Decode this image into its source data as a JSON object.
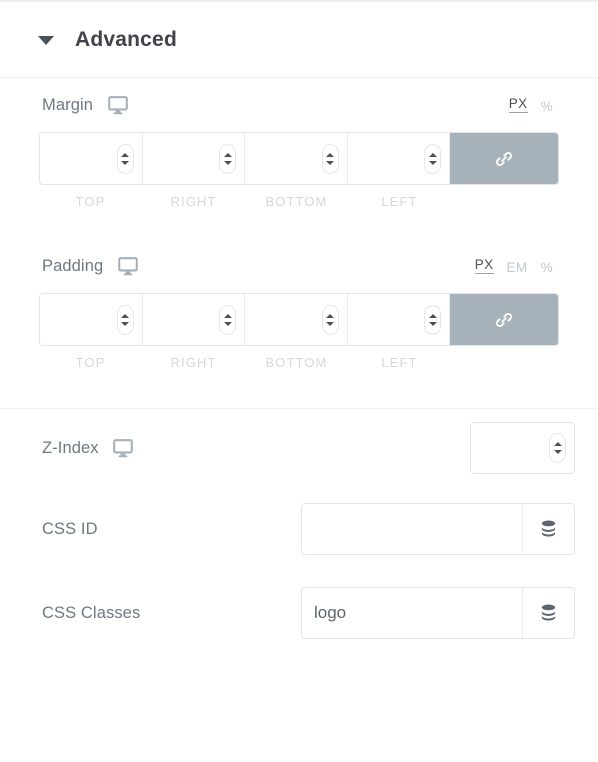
{
  "section": {
    "title": "Advanced",
    "collapse_icon": "caret-down-icon"
  },
  "margin": {
    "label": "Margin",
    "device_icon": "desktop-monitor-icon",
    "units": [
      {
        "label": "PX",
        "active": true
      },
      {
        "label": "%",
        "active": false
      }
    ],
    "fields": [
      {
        "label": "TOP",
        "value": "",
        "placeholder": ""
      },
      {
        "label": "RIGHT",
        "value": "",
        "placeholder": ""
      },
      {
        "label": "BOTTOM",
        "value": "",
        "placeholder": ""
      },
      {
        "label": "LEFT",
        "value": "",
        "placeholder": ""
      }
    ],
    "link_icon": "link-chain-icon",
    "link_bg": "#a6b1ba"
  },
  "padding": {
    "label": "Padding",
    "device_icon": "desktop-monitor-icon",
    "units": [
      {
        "label": "PX",
        "active": true
      },
      {
        "label": "EM",
        "active": false
      },
      {
        "label": "%",
        "active": false
      }
    ],
    "fields": [
      {
        "label": "TOP",
        "value": "",
        "placeholder": ""
      },
      {
        "label": "RIGHT",
        "value": "",
        "placeholder": ""
      },
      {
        "label": "BOTTOM",
        "value": "",
        "placeholder": ""
      },
      {
        "label": "LEFT",
        "value": "",
        "placeholder": ""
      }
    ],
    "link_icon": "link-chain-icon",
    "link_bg": "#a6b1ba"
  },
  "z_index": {
    "label": "Z-Index",
    "device_icon": "desktop-monitor-icon",
    "value": "",
    "placeholder": ""
  },
  "css_id": {
    "label": "CSS ID",
    "value": "",
    "placeholder": "",
    "tag_icon": "database-stack-icon"
  },
  "css_classes": {
    "label": "CSS Classes",
    "value": "logo",
    "placeholder": "",
    "tag_icon": "database-stack-icon"
  },
  "colors": {
    "label_text": "#6d7882",
    "title_text": "#3f444b",
    "muted_text": "#d3d8dc",
    "border": "#e2e5e8",
    "divider": "#eceef0",
    "accent_gray": "#a6b1ba"
  }
}
